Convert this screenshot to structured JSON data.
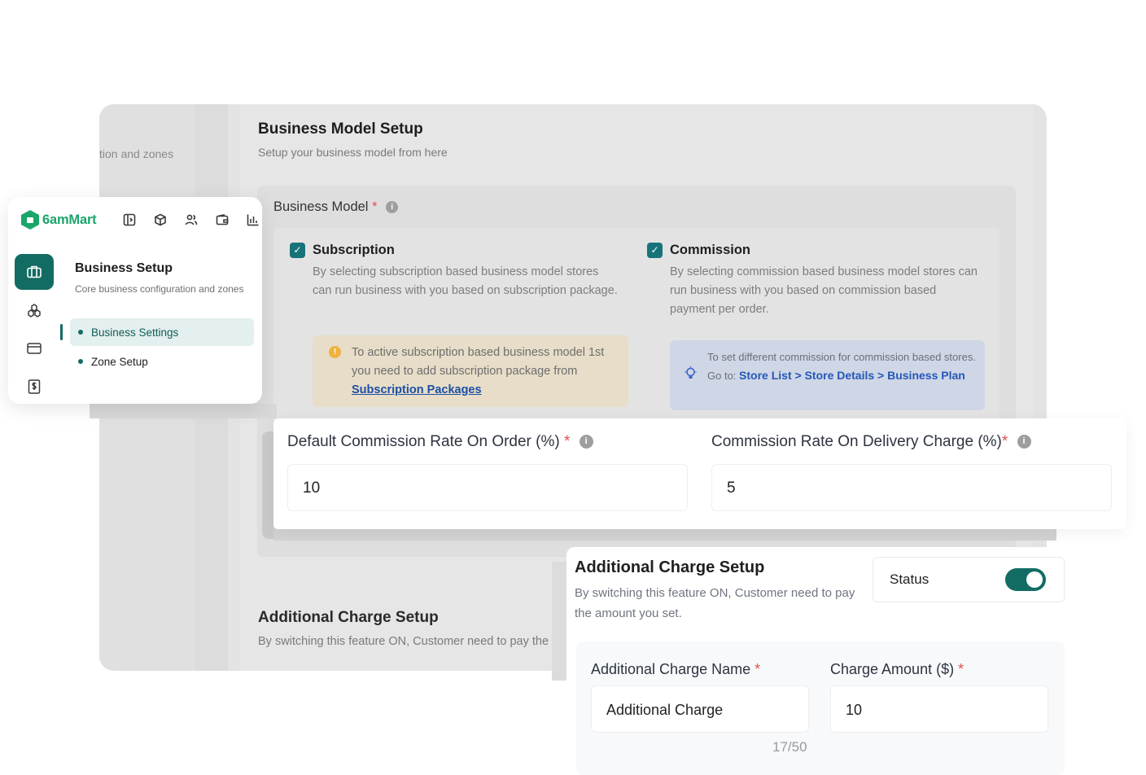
{
  "background": {
    "left_text": "tion and zones",
    "title": "Business Model Setup",
    "subtitle": "Setup your business model from here",
    "business_model_label": "Business Model",
    "required_mark": "*",
    "subscription": {
      "title": "Subscription",
      "description": "By selecting subscription based business model stores can run business with you based on subscription package.",
      "warning_text": "To active subscription based business model 1st you need to add subscription package from",
      "warning_link": "Subscription Packages"
    },
    "commission": {
      "title": "Commission",
      "description": "By selecting commission based business model stores can run business with you based on commission based payment per order.",
      "info_text": "To set different commission for commission based stores. Go to:",
      "info_link": "Store List > Store Details > Business Plan"
    },
    "additional_title": "Additional Charge Setup",
    "additional_sub": "By switching this feature ON, Customer need to pay the"
  },
  "sidebar": {
    "logo": "6amMart",
    "top_icons": [
      "sidebar-toggle-icon",
      "box-icon",
      "users-icon",
      "wallet-icon",
      "chart-icon"
    ],
    "rail_icons": [
      "briefcase-icon",
      "modules-icon",
      "card-icon",
      "invoice-icon"
    ],
    "title": "Business Setup",
    "subtitle": "Core business configuration and zones",
    "items": [
      {
        "label": "Business Settings",
        "active": true
      },
      {
        "label": "Zone Setup",
        "active": false
      }
    ]
  },
  "commission_card": {
    "default_label": "Default Commission Rate On Order (%)",
    "default_value": "10",
    "delivery_label": "Commission Rate On Delivery Charge (%)",
    "delivery_value": "5",
    "required_mark": "*"
  },
  "additional_charge": {
    "title": "Additional Charge Setup",
    "description": "By switching this feature ON, Customer need to pay the amount you set.",
    "status_label": "Status",
    "status_on": true,
    "name_label": "Additional Charge Name",
    "name_value": "Additional Charge",
    "amount_label": "Charge Amount ($)",
    "amount_value": "10",
    "counter": "17/50",
    "required_mark": "*"
  },
  "colors": {
    "brand": "#1aa56a",
    "primary": "#136c63",
    "required": "#e25050",
    "link": "#1c4fa5"
  }
}
